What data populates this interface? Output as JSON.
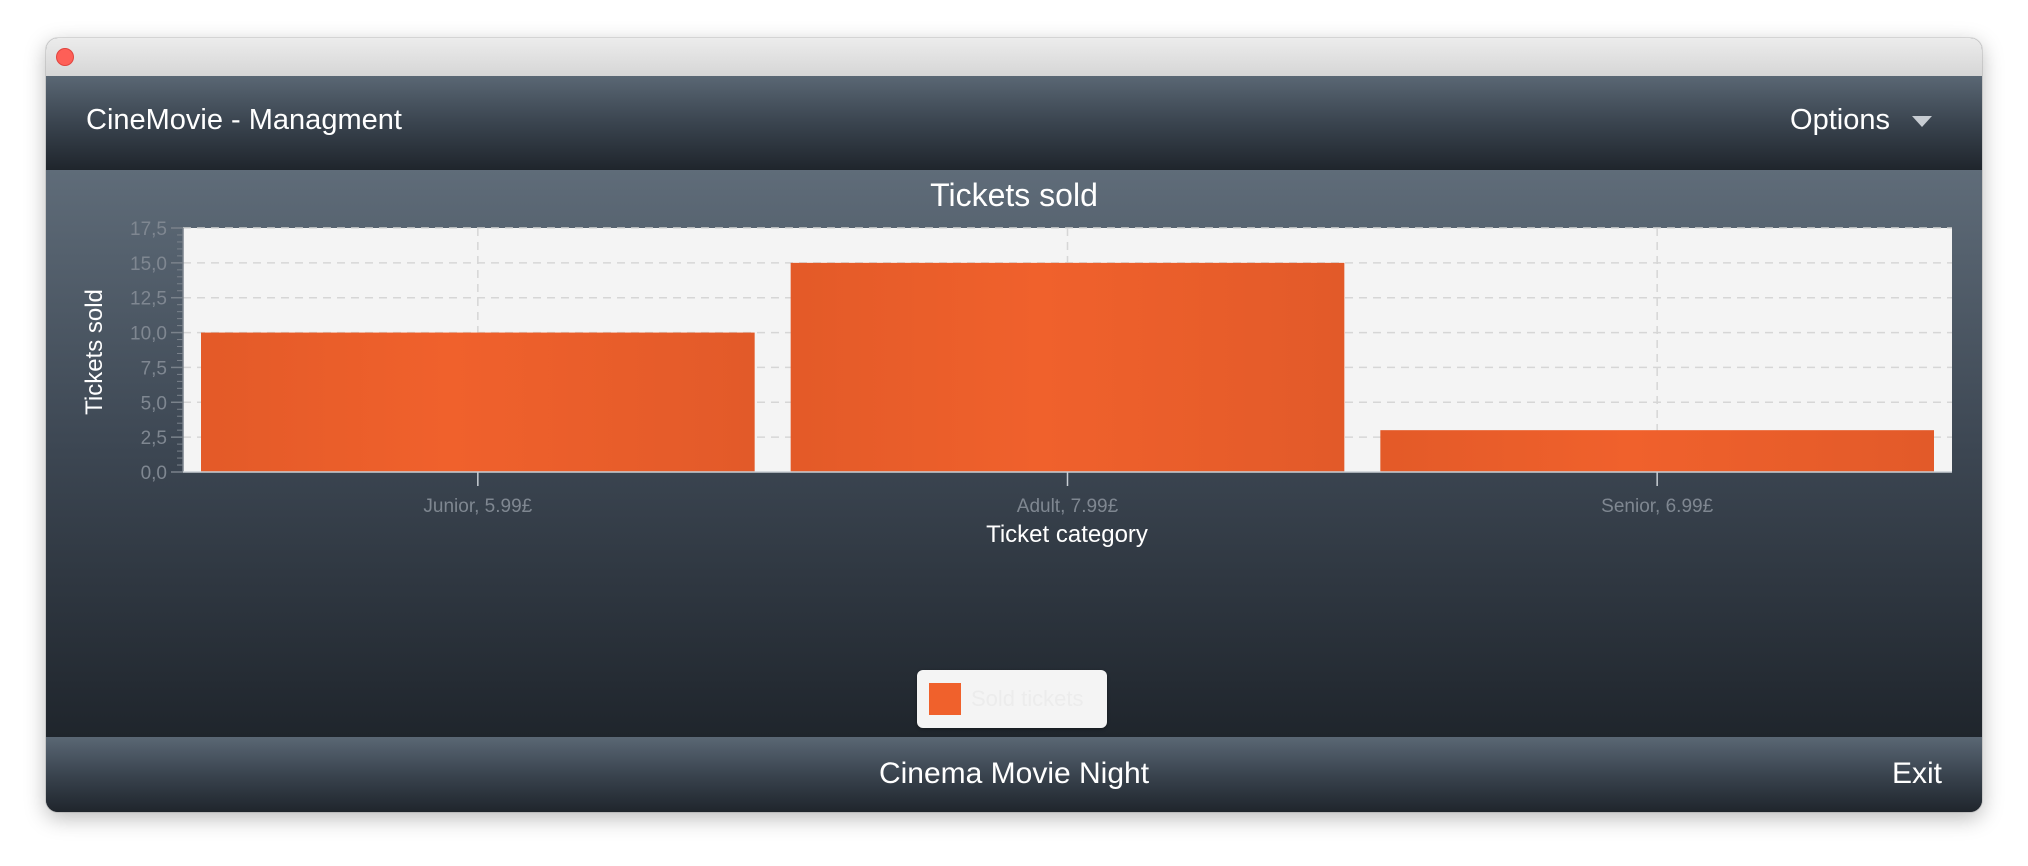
{
  "header": {
    "app_title": "CineMovie - Managment",
    "options_label": "Options"
  },
  "chart_data": {
    "type": "bar",
    "title": "Tickets sold",
    "xlabel": "Ticket category",
    "ylabel": "Tickets sold",
    "categories": [
      "Junior, 5.99£",
      "Adult, 7.99£",
      "Senior, 6.99£"
    ],
    "series": [
      {
        "name": "Sold tickets",
        "values": [
          10,
          15,
          3
        ]
      }
    ],
    "ylim": [
      0,
      17.5
    ],
    "yticks": [
      "0,0",
      "2,5",
      "5,0",
      "7,5",
      "10,0",
      "12,5",
      "15,0",
      "17,5"
    ],
    "grid": true,
    "legend_position": "bottom",
    "colors": {
      "bar": "#f0612c",
      "plot_background": "#f4f4f4",
      "gridline": "#d6d6d6"
    }
  },
  "footer": {
    "title": "Cinema Movie Night",
    "exit_label": "Exit"
  }
}
